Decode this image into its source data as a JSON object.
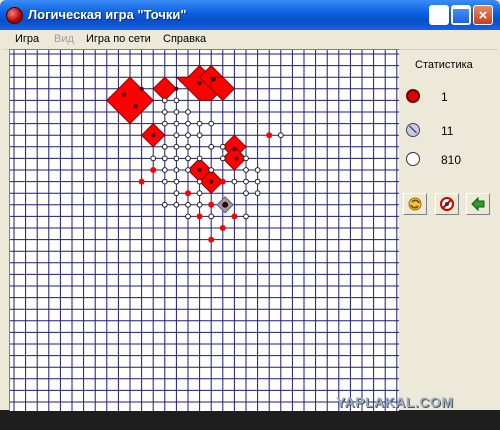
{
  "window": {
    "title": "Логическая игра \"Точки\""
  },
  "menu": [
    {
      "label": "Игра",
      "enabled": true
    },
    {
      "label": "Вид",
      "enabled": false
    },
    {
      "label": "Игра по сети",
      "enabled": true
    },
    {
      "label": "Справка",
      "enabled": true
    }
  ],
  "stats": {
    "title": "Статистика",
    "player1_score": "1",
    "player2_score": "11",
    "free_points": "810"
  },
  "board": {
    "grid_color": "#1c1c78",
    "player1_color": "#ff0000",
    "player2_color": "#9a9ab0"
  },
  "toolbar": {
    "icons": [
      "refresh-icon",
      "cancel-icon",
      "back-arrow-icon"
    ]
  },
  "watermark": "YAPLAKAL.COM"
}
